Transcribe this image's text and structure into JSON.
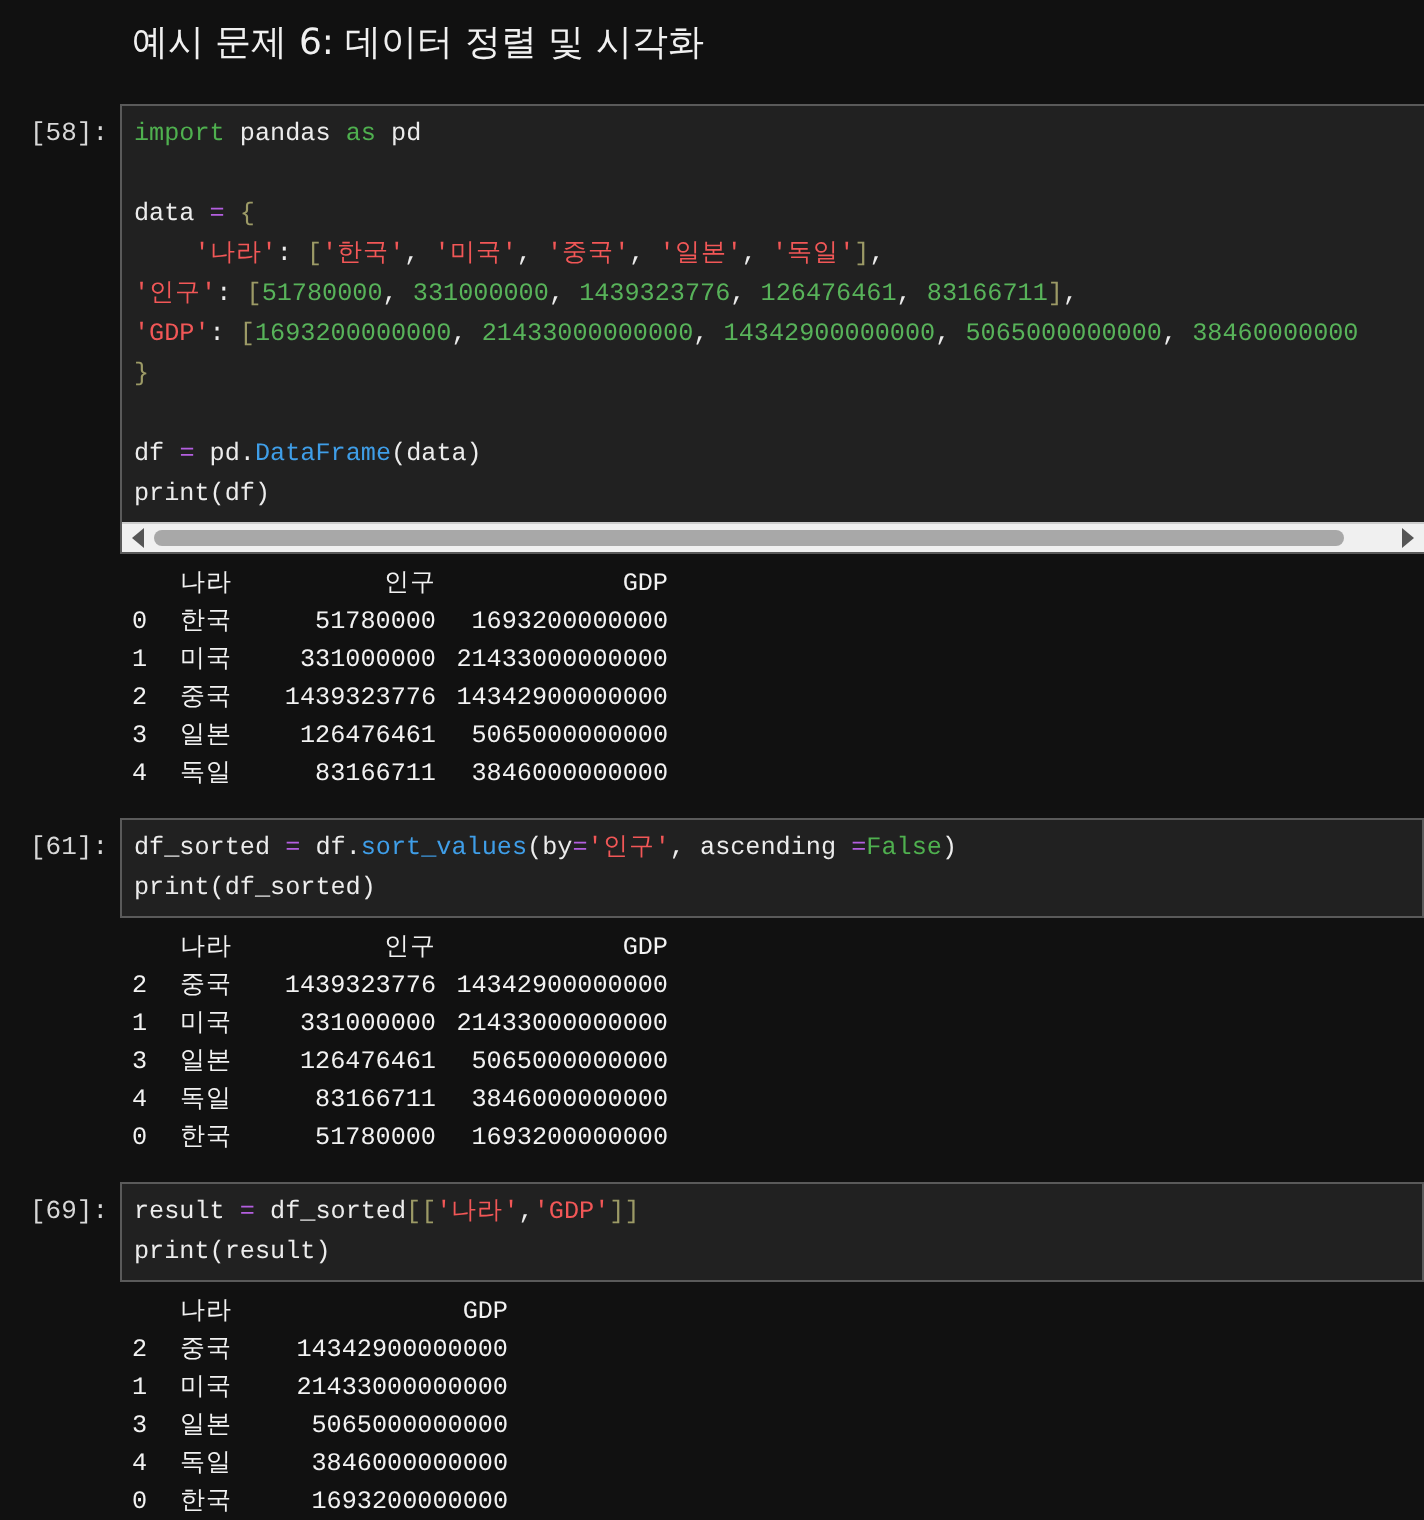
{
  "title": "예시 문제 6: 데이터 정렬 및 시각화",
  "cells": [
    {
      "prompt": "[58]:",
      "horizontal_scrollbar": true,
      "code": [
        {
          "kind": "code",
          "tokens": [
            {
              "kind": "keyword",
              "text": "import"
            },
            {
              "kind": "plain",
              "text": " pandas "
            },
            {
              "kind": "keyword",
              "text": "as"
            },
            {
              "kind": "plain",
              "text": " pd"
            }
          ]
        },
        {
          "kind": "blank"
        },
        {
          "kind": "code",
          "tokens": [
            {
              "kind": "plain",
              "text": "data "
            },
            {
              "kind": "operator",
              "text": "="
            },
            {
              "kind": "bracket",
              "text": " {"
            }
          ]
        },
        {
          "kind": "code",
          "tokens": [
            {
              "kind": "string",
              "text": "    '나라'"
            },
            {
              "kind": "plain",
              "text": ": "
            },
            {
              "kind": "bracket",
              "text": "["
            },
            {
              "kind": "string",
              "text": "'한국'"
            },
            {
              "kind": "plain",
              "text": ", "
            },
            {
              "kind": "string",
              "text": "'미국'"
            },
            {
              "kind": "plain",
              "text": ", "
            },
            {
              "kind": "string",
              "text": "'중국'"
            },
            {
              "kind": "plain",
              "text": ", "
            },
            {
              "kind": "string",
              "text": "'일본'"
            },
            {
              "kind": "plain",
              "text": ", "
            },
            {
              "kind": "string",
              "text": "'독일'"
            },
            {
              "kind": "bracket",
              "text": "]"
            },
            {
              "kind": "plain",
              "text": ","
            }
          ]
        },
        {
          "kind": "code",
          "tokens": [
            {
              "kind": "string",
              "text": "'인구'"
            },
            {
              "kind": "plain",
              "text": ": "
            },
            {
              "kind": "bracket",
              "text": "["
            },
            {
              "kind": "number",
              "text": "51780000"
            },
            {
              "kind": "plain",
              "text": ", "
            },
            {
              "kind": "number",
              "text": "331000000"
            },
            {
              "kind": "plain",
              "text": ", "
            },
            {
              "kind": "number",
              "text": "1439323776"
            },
            {
              "kind": "plain",
              "text": ", "
            },
            {
              "kind": "number",
              "text": "126476461"
            },
            {
              "kind": "plain",
              "text": ", "
            },
            {
              "kind": "number",
              "text": "83166711"
            },
            {
              "kind": "bracket",
              "text": "]"
            },
            {
              "kind": "plain",
              "text": ","
            }
          ]
        },
        {
          "kind": "code",
          "tokens": [
            {
              "kind": "string",
              "text": "'GDP'"
            },
            {
              "kind": "plain",
              "text": ": "
            },
            {
              "kind": "bracket",
              "text": "["
            },
            {
              "kind": "number",
              "text": "1693200000000"
            },
            {
              "kind": "plain",
              "text": ", "
            },
            {
              "kind": "number",
              "text": "21433000000000"
            },
            {
              "kind": "plain",
              "text": ", "
            },
            {
              "kind": "number",
              "text": "14342900000000"
            },
            {
              "kind": "plain",
              "text": ", "
            },
            {
              "kind": "number",
              "text": "5065000000000"
            },
            {
              "kind": "plain",
              "text": ", "
            },
            {
              "kind": "number",
              "text": "38460000000"
            }
          ]
        },
        {
          "kind": "code",
          "tokens": [
            {
              "kind": "bracket",
              "text": "}"
            }
          ]
        },
        {
          "kind": "blank"
        },
        {
          "kind": "code",
          "tokens": [
            {
              "kind": "plain",
              "text": "df "
            },
            {
              "kind": "operator",
              "text": "="
            },
            {
              "kind": "plain",
              "text": " pd."
            },
            {
              "kind": "function",
              "text": "DataFrame"
            },
            {
              "kind": "plain",
              "text": "(data)"
            }
          ]
        },
        {
          "kind": "code",
          "tokens": [
            {
              "kind": "plain",
              "text": "print(df)"
            }
          ]
        }
      ],
      "output": {
        "columns": [
          "나라",
          "인구",
          "GDP"
        ],
        "rows": [
          {
            "index": "0",
            "values": [
              "한국",
              "51780000",
              "1693200000000"
            ]
          },
          {
            "index": "1",
            "values": [
              "미국",
              "331000000",
              "21433000000000"
            ]
          },
          {
            "index": "2",
            "values": [
              "중국",
              "1439323776",
              "14342900000000"
            ]
          },
          {
            "index": "3",
            "values": [
              "일본",
              "126476461",
              "5065000000000"
            ]
          },
          {
            "index": "4",
            "values": [
              "독일",
              "83166711",
              "3846000000000"
            ]
          }
        ]
      }
    },
    {
      "prompt": "[61]:",
      "horizontal_scrollbar": false,
      "code": [
        {
          "kind": "code",
          "tokens": [
            {
              "kind": "plain",
              "text": "df_sorted "
            },
            {
              "kind": "operator",
              "text": "="
            },
            {
              "kind": "plain",
              "text": " df."
            },
            {
              "kind": "function",
              "text": "sort_values"
            },
            {
              "kind": "plain",
              "text": "(by"
            },
            {
              "kind": "operator",
              "text": "="
            },
            {
              "kind": "string",
              "text": "'인구'"
            },
            {
              "kind": "plain",
              "text": ", ascending "
            },
            {
              "kind": "operator",
              "text": "="
            },
            {
              "kind": "constant",
              "text": "False"
            },
            {
              "kind": "plain",
              "text": ")"
            }
          ]
        },
        {
          "kind": "code",
          "tokens": [
            {
              "kind": "plain",
              "text": "print(df_sorted)"
            }
          ]
        }
      ],
      "output": {
        "columns": [
          "나라",
          "인구",
          "GDP"
        ],
        "rows": [
          {
            "index": "2",
            "values": [
              "중국",
              "1439323776",
              "14342900000000"
            ]
          },
          {
            "index": "1",
            "values": [
              "미국",
              "331000000",
              "21433000000000"
            ]
          },
          {
            "index": "3",
            "values": [
              "일본",
              "126476461",
              "5065000000000"
            ]
          },
          {
            "index": "4",
            "values": [
              "독일",
              "83166711",
              "3846000000000"
            ]
          },
          {
            "index": "0",
            "values": [
              "한국",
              "51780000",
              "1693200000000"
            ]
          }
        ]
      }
    },
    {
      "prompt": "[69]:",
      "horizontal_scrollbar": false,
      "code": [
        {
          "kind": "code",
          "tokens": [
            {
              "kind": "plain",
              "text": "result "
            },
            {
              "kind": "operator",
              "text": "="
            },
            {
              "kind": "plain",
              "text": " df_sorted"
            },
            {
              "kind": "bracket",
              "text": "[["
            },
            {
              "kind": "string",
              "text": "'나라'"
            },
            {
              "kind": "plain",
              "text": ","
            },
            {
              "kind": "string",
              "text": "'GDP'"
            },
            {
              "kind": "bracket",
              "text": "]]"
            }
          ]
        },
        {
          "kind": "code",
          "tokens": [
            {
              "kind": "plain",
              "text": "print(result)"
            }
          ]
        }
      ],
      "output": {
        "columns": [
          "나라",
          "GDP"
        ],
        "rows": [
          {
            "index": "2",
            "values": [
              "중국",
              "14342900000000"
            ]
          },
          {
            "index": "1",
            "values": [
              "미국",
              "21433000000000"
            ]
          },
          {
            "index": "3",
            "values": [
              "일본",
              "5065000000000"
            ]
          },
          {
            "index": "4",
            "values": [
              "독일",
              "3846000000000"
            ]
          },
          {
            "index": "0",
            "values": [
              "한국",
              "1693200000000"
            ]
          }
        ]
      }
    }
  ]
}
